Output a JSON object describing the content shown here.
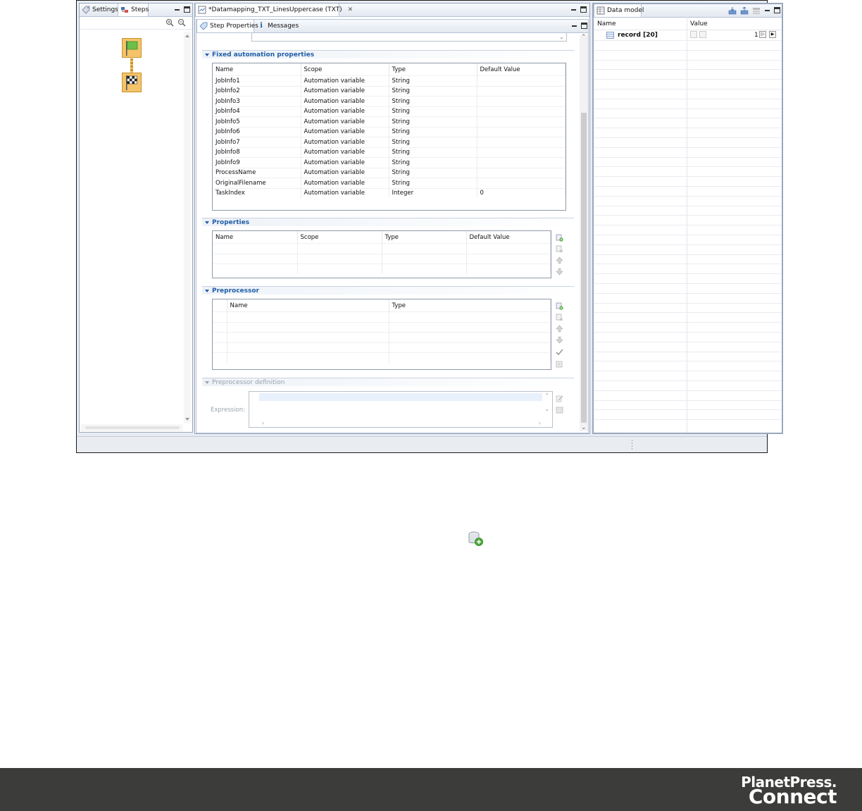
{
  "left_panel": {
    "tabs": [
      {
        "label": "Settings"
      },
      {
        "label": "Steps"
      }
    ]
  },
  "editor": {
    "tab_title": "*Datamapping_TXT_LinesUppercase (TXT)",
    "subtabs": [
      {
        "label": "Step Properties"
      },
      {
        "label": "Messages"
      }
    ],
    "fixed_section": {
      "title": "Fixed automation properties",
      "columns": [
        "Name",
        "Scope",
        "Type",
        "Default Value"
      ],
      "rows": [
        [
          "JobInfo1",
          "Automation variable",
          "String",
          ""
        ],
        [
          "JobInfo2",
          "Automation variable",
          "String",
          ""
        ],
        [
          "JobInfo3",
          "Automation variable",
          "String",
          ""
        ],
        [
          "JobInfo4",
          "Automation variable",
          "String",
          ""
        ],
        [
          "JobInfo5",
          "Automation variable",
          "String",
          ""
        ],
        [
          "JobInfo6",
          "Automation variable",
          "String",
          ""
        ],
        [
          "JobInfo7",
          "Automation variable",
          "String",
          ""
        ],
        [
          "JobInfo8",
          "Automation variable",
          "String",
          ""
        ],
        [
          "JobInfo9",
          "Automation variable",
          "String",
          ""
        ],
        [
          "ProcessName",
          "Automation variable",
          "String",
          ""
        ],
        [
          "OriginalFilename",
          "Automation variable",
          "String",
          ""
        ],
        [
          "TaskIndex",
          "Automation variable",
          "Integer",
          "0"
        ]
      ]
    },
    "properties_section": {
      "title": "Properties",
      "columns": [
        "Name",
        "Scope",
        "Type",
        "Default Value"
      ]
    },
    "preprocessor_section": {
      "title": "Preprocessor",
      "columns": [
        "",
        "Name",
        "Type"
      ]
    },
    "preprocessor_definition": {
      "title": "Preprocessor definition",
      "expression_label": "Expression:"
    }
  },
  "data_model": {
    "tab_title": "Data model",
    "columns": [
      "Name",
      "Value"
    ],
    "record_label": "record [20]",
    "record_index": "1"
  },
  "footer": {
    "logo_line1": "PlanetPress.",
    "logo_line2": "Connect"
  }
}
